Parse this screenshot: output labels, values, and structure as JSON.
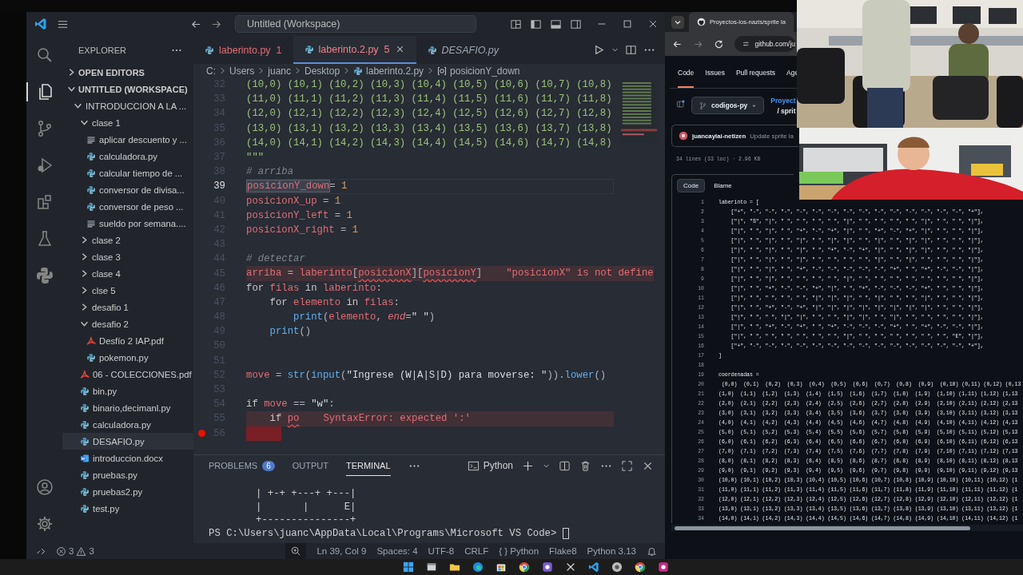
{
  "vscode": {
    "title_bar": {
      "workspace": "Untitled (Workspace)"
    },
    "explorer": {
      "title": "EXPLORER",
      "sections": [
        {
          "label": "OPEN EDITORS",
          "expanded": false
        },
        {
          "label": "UNTITLED (WORKSPACE)",
          "expanded": true
        }
      ],
      "tree": [
        {
          "label": "INTRODUCCION A LA ...",
          "kind": "folder",
          "expanded": true,
          "selected": false,
          "children": [
            {
              "label": "clase 1",
              "kind": "folder",
              "expanded": true,
              "selected": false,
              "children": [
                {
                  "label": "aplicar descuento y ...",
                  "kind": "text",
                  "selected": false
                },
                {
                  "label": "calculadora.py",
                  "kind": "python",
                  "selected": false
                },
                {
                  "label": "calcular tiempo de ...",
                  "kind": "python",
                  "selected": false
                },
                {
                  "label": "conversor de divisa...",
                  "kind": "python",
                  "selected": false
                },
                {
                  "label": "conversor de peso ...",
                  "kind": "python",
                  "selected": false
                },
                {
                  "label": "sueldo por semana....",
                  "kind": "text",
                  "selected": false
                }
              ]
            },
            {
              "label": "clase 2",
              "kind": "folder",
              "expanded": false,
              "selected": false
            },
            {
              "label": "clase 3",
              "kind": "folder",
              "expanded": false,
              "selected": false
            },
            {
              "label": "clase 4",
              "kind": "folder",
              "expanded": false,
              "selected": false
            },
            {
              "label": "clse 5",
              "kind": "folder",
              "expanded": false,
              "selected": false
            },
            {
              "label": "desafio 1",
              "kind": "folder",
              "expanded": false,
              "selected": false
            },
            {
              "label": "desafio 2",
              "kind": "folder",
              "expanded": true,
              "selected": false,
              "children": [
                {
                  "label": "Desfío 2 IAP.pdf",
                  "kind": "pdf",
                  "selected": false
                },
                {
                  "label": "pokemon.py",
                  "kind": "python",
                  "selected": false
                }
              ]
            },
            {
              "label": "06 - COLECCIONES.pdf",
              "kind": "pdf",
              "selected": false
            },
            {
              "label": "bin.py",
              "kind": "python",
              "selected": false
            },
            {
              "label": "binario,decimanl.py",
              "kind": "python",
              "selected": false
            },
            {
              "label": "calculadora.py",
              "kind": "python",
              "selected": false
            },
            {
              "label": "DESAFIO.py",
              "kind": "python",
              "selected": true
            },
            {
              "label": "introduccion.docx",
              "kind": "word",
              "selected": false
            },
            {
              "label": "pruebas.py",
              "kind": "python",
              "selected": false
            },
            {
              "label": "pruebas2.py",
              "kind": "python",
              "selected": false
            },
            {
              "label": "test.py",
              "kind": "python",
              "selected": false
            }
          ]
        }
      ]
    },
    "tabs": [
      {
        "label": "laberinto.py",
        "badge": "1",
        "selected": false,
        "has_errors": true,
        "preview": false
      },
      {
        "label": "laberinto.2.py",
        "badge": "5",
        "selected": true,
        "has_errors": true,
        "preview": false
      },
      {
        "label": "DESAFIO.py",
        "selected": false,
        "has_errors": false,
        "preview": true
      }
    ],
    "breadcrumbs": [
      {
        "label": "C:",
        "kind": "text"
      },
      {
        "label": "Users",
        "kind": "text"
      },
      {
        "label": "juanc",
        "kind": "text"
      },
      {
        "label": "Desktop",
        "kind": "text"
      },
      {
        "label": "laberinto.2.py",
        "kind": "python"
      },
      {
        "label": "posicionY_down",
        "kind": "symbol"
      }
    ],
    "lines": [
      {
        "n": "32",
        "tokens": [
          {
            "kind": "str",
            "text": "(10,0) (10,1) (10,2) (10,3) (10,4) (10,5) (10,6) (10,7) (10,8)"
          }
        ]
      },
      {
        "n": "33",
        "tokens": [
          {
            "kind": "str",
            "text": "(11,0) (11,1) (11,2) (11,3) (11,4) (11,5) (11,6) (11,7) (11,8)"
          }
        ]
      },
      {
        "n": "34",
        "tokens": [
          {
            "kind": "str",
            "text": "(12,0) (12,1) (12,2) (12,3) (12,4) (12,5) (12,6) (12,7) (12,8)"
          }
        ]
      },
      {
        "n": "35",
        "tokens": [
          {
            "kind": "str",
            "text": "(13,0) (13,1) (13,2) (13,3) (13,4) (13,5) (13,6) (13,7) (13,8)"
          }
        ]
      },
      {
        "n": "36",
        "tokens": [
          {
            "kind": "str",
            "text": "(14,0) (14,1) (14,2) (14,3) (14,4) (14,5) (14,6) (14,7) (14,8)"
          }
        ]
      },
      {
        "n": "37",
        "tokens": [
          {
            "kind": "str",
            "text": "\"\"\""
          }
        ]
      },
      {
        "n": "38",
        "tokens": [
          {
            "kind": "com",
            "text": "# arriba"
          }
        ]
      },
      {
        "n": "39",
        "current": true,
        "tokens": [
          {
            "kind": "sel",
            "text": "posicionY_down"
          },
          {
            "kind": "pun",
            "text": "= "
          },
          {
            "kind": "num",
            "text": "1"
          }
        ]
      },
      {
        "n": "40",
        "tokens": [
          {
            "kind": "var",
            "text": "posicionX_up"
          },
          {
            "kind": "pun",
            "text": " = "
          },
          {
            "kind": "num",
            "text": "1"
          }
        ]
      },
      {
        "n": "41",
        "tokens": [
          {
            "kind": "var",
            "text": "posicionY_left"
          },
          {
            "kind": "pun",
            "text": " = "
          },
          {
            "kind": "num",
            "text": "1"
          }
        ]
      },
      {
        "n": "42",
        "tokens": [
          {
            "kind": "var",
            "text": "posicionX_right"
          },
          {
            "kind": "pun",
            "text": " = "
          },
          {
            "kind": "num",
            "text": "1"
          }
        ]
      },
      {
        "n": "43"
      },
      {
        "n": "44",
        "tokens": [
          {
            "kind": "com",
            "text": "# detectar"
          }
        ]
      },
      {
        "n": "45",
        "error": true,
        "diagnostic": "\"posicionX\" is not define",
        "tokens": [
          {
            "kind": "var",
            "text": "arriba"
          },
          {
            "kind": "pun",
            "text": " = "
          },
          {
            "kind": "var",
            "text": "laberinto"
          },
          {
            "kind": "pun",
            "text": "["
          },
          {
            "kind": "err",
            "text": "posicionX"
          },
          {
            "kind": "pun",
            "text": "]["
          },
          {
            "kind": "err",
            "text": "posicionY"
          },
          {
            "kind": "pun",
            "text": "]"
          }
        ]
      },
      {
        "n": "46",
        "tokens": [
          {
            "kind": "kw",
            "text": "for "
          },
          {
            "kind": "var",
            "text": "filas"
          },
          {
            "kind": "kw",
            "text": " in "
          },
          {
            "kind": "var",
            "text": "laberinto"
          },
          {
            "kind": "pun",
            "text": ":"
          }
        ]
      },
      {
        "n": "47",
        "tokens": [
          {
            "kind": "kw",
            "text": "    for "
          },
          {
            "kind": "var",
            "text": "elemento"
          },
          {
            "kind": "kw",
            "text": " in "
          },
          {
            "kind": "var",
            "text": "filas"
          },
          {
            "kind": "pun",
            "text": ":"
          }
        ]
      },
      {
        "n": "48",
        "tokens": [
          {
            "kind": "fn",
            "text": "        print"
          },
          {
            "kind": "pun",
            "text": "("
          },
          {
            "kind": "var",
            "text": "elemento"
          },
          {
            "kind": "pun",
            "text": ", "
          },
          {
            "kind": "param",
            "text": "end"
          },
          {
            "kind": "pun",
            "text": "="
          },
          {
            "kind": "plain",
            "text": "\" \""
          },
          {
            "kind": "pun",
            "text": ")"
          }
        ]
      },
      {
        "n": "49",
        "tokens": [
          {
            "kind": "fn",
            "text": "    print"
          },
          {
            "kind": "pun",
            "text": "()"
          }
        ]
      },
      {
        "n": "50"
      },
      {
        "n": "51"
      },
      {
        "n": "52",
        "tokens": [
          {
            "kind": "var",
            "text": "move"
          },
          {
            "kind": "pun",
            "text": " = "
          },
          {
            "kind": "fn",
            "text": "str"
          },
          {
            "kind": "pun",
            "text": "("
          },
          {
            "kind": "fn",
            "text": "input"
          },
          {
            "kind": "pun",
            "text": "("
          },
          {
            "kind": "plain",
            "text": "\"Ingrese (W|A|S|D) para moverse: \""
          },
          {
            "kind": "pun",
            "text": "))."
          },
          {
            "kind": "fn",
            "text": "lower"
          },
          {
            "kind": "pun",
            "text": "()"
          }
        ]
      },
      {
        "n": "53"
      },
      {
        "n": "54",
        "tokens": [
          {
            "kind": "kw",
            "text": "if "
          },
          {
            "kind": "var",
            "text": "move"
          },
          {
            "kind": "pun",
            "text": " == "
          },
          {
            "kind": "plain",
            "text": "\"w\""
          },
          {
            "kind": "pun",
            "text": ":"
          }
        ]
      },
      {
        "n": "55",
        "error": true,
        "diagnostic": "SyntaxError: expected ':'",
        "tokens": [
          {
            "kind": "kw",
            "text": "    if "
          },
          {
            "kind": "err",
            "text": "po"
          }
        ]
      },
      {
        "n": "56",
        "breakpoint": true,
        "error_block": true
      }
    ],
    "panel": {
      "tabs": [
        {
          "label": "PROBLEMS",
          "count": "6",
          "selected": false
        },
        {
          "label": "OUTPUT",
          "selected": false
        },
        {
          "label": "TERMINAL",
          "selected": true
        }
      ],
      "profile": "Python",
      "terminal": [
        "        | +-+ +---+ +---|",
        "        |       |      E|",
        "        +---------------+",
        "PS C:\\Users\\juanc\\AppData\\Local\\Programs\\Microsoft VS Code> "
      ]
    },
    "status": {
      "errors": "3",
      "warnings": "3",
      "items": [
        "Ln 39, Col 9",
        "Spaces: 4",
        "UTF-8",
        "CRLF",
        "{ } Python",
        "Flake8",
        "Python 3.13"
      ]
    }
  },
  "browser": {
    "tab_title": "Proyectos-los-nazis/sprite la",
    "url": "github.com/ju",
    "nav": [
      {
        "label": "Code",
        "selected": true
      },
      {
        "label": "Issues",
        "selected": false
      },
      {
        "label": "Pull requests",
        "selected": false
      },
      {
        "label": "Age",
        "selected": false
      }
    ],
    "branch": "codigos-py",
    "repo_path": "Proyect",
    "file_path": "/ sprit",
    "commit": {
      "author": "juancaylai-netizen",
      "message": "Update sprite la"
    },
    "file_info": "34 lines (33 loc) · 2.96 KB",
    "view_toggle": [
      {
        "label": "Code",
        "selected": true
      },
      {
        "label": "Blame",
        "selected": false
      }
    ],
    "code": [
      {
        "n": "1",
        "text": "laberinto = ["
      },
      {
        "n": "2",
        "text": "    [\"+\", \"-\", \"-\", \"-\", \"-\", \"-\", \"-\", \"-\", \"-\", \"-\", \"-\", \"-\", \"-\", \"-\", \"-\", \"+\"],"
      },
      {
        "n": "3",
        "text": "    [\"|\", \"S\", \"|\", \" \", \" \", \" \", \" \", \"|\", \" \", \" \", \" \", \" \", \"|\", \" \", \" \", \"|\"],"
      },
      {
        "n": "4",
        "text": "    [\"|\", \" \", \"|\", \" \", \"+\", \"-\", \"+\", \"|\", \" \", \"+\", \"-\", \"+\", \"|\", \" \", \" \", \"|\"],"
      },
      {
        "n": "5",
        "text": "    [\"|\", \" \", \"|\", \" \", \"|\", \" \", \"|\", \"|\", \" \", \"|\", \" \", \"|\", \"|\", \" \", \" \", \"|\"],"
      },
      {
        "n": "6",
        "text": "    [\"|\", \" \", \"|\", \" \", \"|\", \" \", \"+\", \"-\", \"+\", \"|\", \" \", \"|\", \"|\", \" \", \" \", \"|\"],"
      },
      {
        "n": "7",
        "text": "    [\"|\", \" \", \"|\", \" \", \"|\", \" \", \" \", \" \", \" \", \"|\", \" \", \"|\", \" \", \" \", \" \", \"|\"],"
      },
      {
        "n": "8",
        "text": "    [\"|\", \" \", \"|\", \" \", \"+\", \"-\", \"-\", \"-\", \"-\", \"-\", \"+\", \" \", \"+\", \"-\", \"-\", \"|\"],"
      },
      {
        "n": "9",
        "text": "    [\"|\", \" \", \"|\", \" \", \" \", \" \", \" \", \"|\", \" \", \" \", \" \", \" \", \" \", \" \", \" \", \"|\"],"
      },
      {
        "n": "10",
        "text": "    [\"|\", \" \", \"+\", \"-\", \"-\", \"+\", \"|\", \" \", \"+\", \"-\", \"-\", \"-\", \"+\", \" \", \" \", \"|\"],"
      },
      {
        "n": "11",
        "text": "    [\"|\", \" \", \" \", \" \", \" \", \"|\", \"|\", \"|\", \" \", \"|\", \" \", \" \", \"|\", \" \", \" \", \"|\"],"
      },
      {
        "n": "12",
        "text": "    [\"|\", \" \", \"+\", \"-\", \"+\", \"|\", \"|\", \"|\", \"|\", \"|\", \"|\", \"|\", \"|\", \" \", \" \", \"|\"],"
      },
      {
        "n": "13",
        "text": "    [\"|\", \" \", \" \", \"|\", \"|\", \" \", \" \", \"|\", \"|\", \" \", \"|\", \" \", \" \", \" \", \" \", \"|\"],"
      },
      {
        "n": "14",
        "text": "    [\"|\", \" \", \"+\", \"-\", \"+\", \" \", \"+\", \"-\", \"-\", \"-\", \"+\", \" \", \"+\", \"-\", \"-\", \"|\"],"
      },
      {
        "n": "15",
        "text": "    [\"|\", \" \", \" \", \" \", \" \", \" \", \" \", \"|\", \" \", \" \", \" \", \" \", \" \", \" \", \"E\", \"|\"],"
      },
      {
        "n": "16",
        "text": "    [\"+\", \"-\", \"-\", \"-\", \"-\", \"-\", \"-\", \"-\", \"-\", \"-\", \"-\", \"-\", \"-\", \"-\", \"-\", \"+\"],"
      },
      {
        "n": "17",
        "text": "]"
      },
      {
        "n": "18"
      },
      {
        "n": "19",
        "text": "coordenadas ="
      },
      {
        "n": "20",
        "text": " (0,0)  (0,1)  (0,2)  (0,3)  (0,4)  (0,5)  (0,6)  (0,7)  (0,8)  (0,9)  (0,10) (0,11) (0,12) (0,13"
      },
      {
        "n": "21",
        "text": "(1,0)  (1,1)  (1,2)  (1,3)  (1,4)  (1,5)  (1,6)  (1,7)  (1,8)  (1,9)  (1,10) (1,11) (1,12) (1,13"
      },
      {
        "n": "22",
        "text": "(2,0)  (2,1)  (2,2)  (2,3)  (2,4)  (2,5)  (2,6)  (2,7)  (2,8)  (2,9)  (2,10) (2,11) (2,12) (2,13"
      },
      {
        "n": "23",
        "text": "(3,0)  (3,1)  (3,2)  (3,3)  (3,4)  (3,5)  (3,6)  (3,7)  (3,8)  (3,9)  (3,10) (3,11) (3,12) (3,13"
      },
      {
        "n": "24",
        "text": "(4,0)  (4,1)  (4,2)  (4,3)  (4,4)  (4,5)  (4,6)  (4,7)  (4,8)  (4,9)  (4,10) (4,11) (4,12) (4,13"
      },
      {
        "n": "25",
        "text": "(5,0)  (5,1)  (5,2)  (5,3)  (5,4)  (5,5)  (5,6)  (5,7)  (5,8)  (5,9)  (5,10) (5,11) (5,12) (5,13"
      },
      {
        "n": "26",
        "text": "(6,0)  (6,1)  (6,2)  (6,3)  (6,4)  (6,5)  (6,6)  (6,7)  (6,8)  (6,9)  (6,10) (6,11) (6,12) (6,13"
      },
      {
        "n": "27",
        "text": "(7,0)  (7,1)  (7,2)  (7,3)  (7,4)  (7,5)  (7,6)  (7,7)  (7,8)  (7,9)  (7,10) (7,11) (7,12) (7,13"
      },
      {
        "n": "28",
        "text": "(8,0)  (8,1)  (8,2)  (8,3)  (8,4)  (8,5)  (8,6)  (8,7)  (8,8)  (8,9)  (8,10) (8,11) (8,12) (8,13"
      },
      {
        "n": "29",
        "text": "(9,0)  (9,1)  (9,2)  (9,3)  (9,4)  (9,5)  (9,6)  (9,7)  (9,8)  (9,9)  (9,10) (9,11) (9,12) (9,13"
      },
      {
        "n": "30",
        "text": "(10,0) (10,1) (10,2) (10,3) (10,4) (10,5) (10,6) (10,7) (10,8) (10,9) (10,10) (10,11) (10,12) (1"
      },
      {
        "n": "31",
        "text": "(11,0) (11,1) (11,2) (11,3) (11,4) (11,5) (11,6) (11,7) (11,8) (11,9) (11,10) (11,11) (11,12) (1"
      },
      {
        "n": "32",
        "text": "(12,0) (12,1) (12,2) (12,3) (12,4) (12,5) (12,6) (12,7) (12,8) (12,9) (12,10) (12,11) (12,12) (1"
      },
      {
        "n": "33",
        "text": "(13,0) (13,1) (13,2) (13,3) (13,4) (13,5) (13,6) (13,7) (13,8) (13,9) (13,10) (13,11) (13,12) (1"
      },
      {
        "n": "34",
        "text": "(14,0) (14,1) (14,2) (14,3) (14,4) (14,5) (14,6) (14,7) (14,8) (14,9) (14,10) (14,11) (14,12) (1"
      }
    ]
  }
}
